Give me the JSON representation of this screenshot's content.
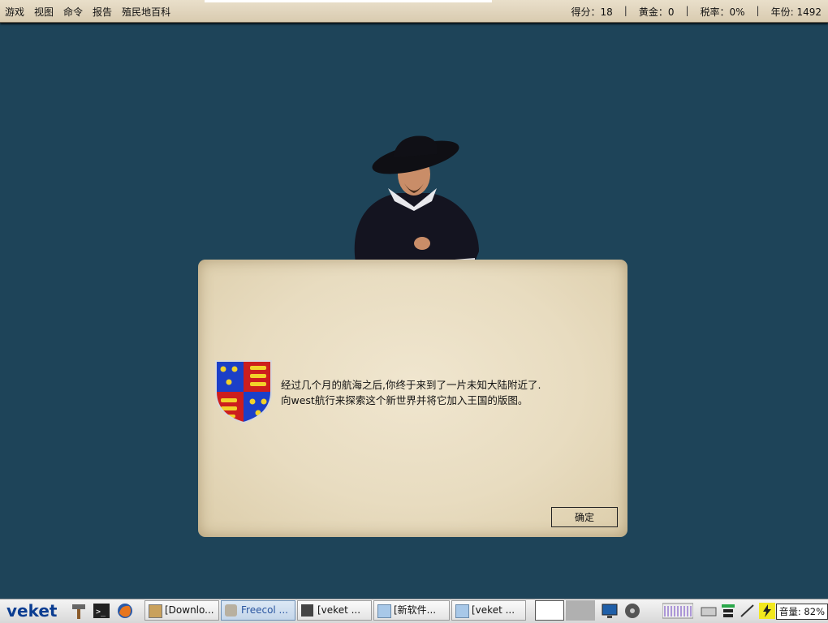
{
  "menubar": {
    "menus": [
      "游戏",
      "视图",
      "命令",
      "报告",
      "殖民地百科"
    ],
    "score": "得分：18",
    "gold": "黄金：0",
    "tax": "税率：0%",
    "year": "年份: 1492",
    "separator": "|"
  },
  "dialog": {
    "message": "经过几个月的航海之后,你终于来到了一片未知大陆附近了.向west航行来探索这个新世界并将它加入王国的版图。",
    "ok_label": "确定"
  },
  "taskbar": {
    "start_label": "veket",
    "tasks": [
      {
        "label": "[Downlo...",
        "active": false
      },
      {
        "label": "Freecol ...",
        "active": true
      },
      {
        "label": "[veket ...",
        "active": false
      },
      {
        "label": "[新软件...",
        "active": false
      },
      {
        "label": "[veket ...",
        "active": false
      }
    ],
    "volume": "音量: 82%"
  },
  "colors": {
    "background": "#1e4459",
    "parchment": "#e8dcc0",
    "menubar": "#e2d6bd"
  }
}
